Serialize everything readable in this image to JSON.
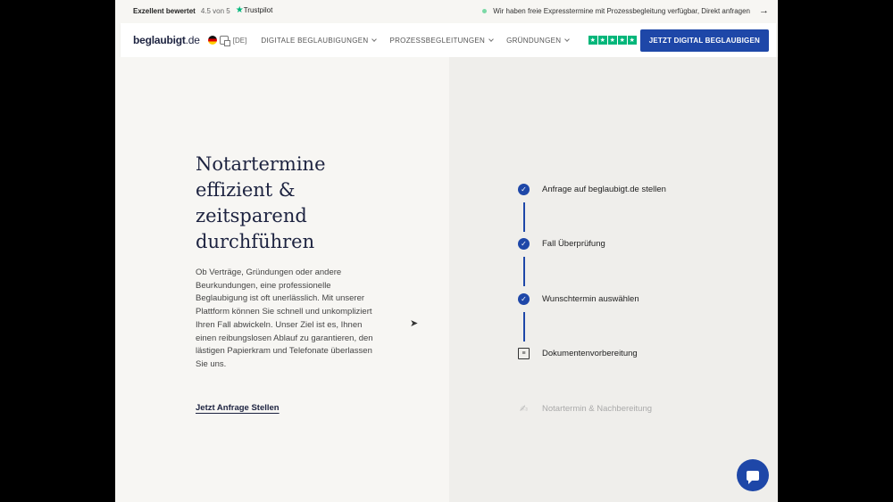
{
  "topbar": {
    "rating_label": "Exzellent bewertet",
    "rating_value": "4.5 von 5",
    "trustpilot": "Trustpilot",
    "promo": "Wir haben freie Expresstermine mit Prozessbegleitung verfügbar, Direkt anfragen"
  },
  "nav": {
    "logo_main": "beglaubigt",
    "logo_tld": ".de",
    "lang": "[DE]",
    "menu": [
      "DIGITALE BEGLAUBIGUNGEN",
      "PROZESSBEGLEITUNGEN",
      "GRÜNDUNGEN"
    ],
    "cta": "JETZT DIGITAL BEGLAUBIGEN"
  },
  "hero": {
    "headline": "Notartermine\neffizient &\nzeitsparend\ndurchführen",
    "body": "Ob Verträge, Gründungen oder andere Beurkundungen, eine professionelle Beglaubigung ist oft unerlässlich. Mit unserer Plattform können Sie schnell und unkompliziert Ihren Fall abwickeln. Unser Ziel ist es, Ihnen einen reibungslosen Ablauf zu garantieren, den lästigen Papierkram und Telefonate überlassen Sie uns.",
    "link": "Jetzt Anfrage Stellen"
  },
  "steps": [
    {
      "label": "Anfrage auf beglaubigt.de stellen",
      "icon": "check-circle-icon",
      "state": "done"
    },
    {
      "label": "Fall Überprüfung",
      "icon": "check-circle-icon",
      "state": "done"
    },
    {
      "label": "Wunschtermin auswählen",
      "icon": "check-circle-icon",
      "state": "done"
    },
    {
      "label": "Dokumentenvorbereitung",
      "icon": "document-icon",
      "state": "current"
    },
    {
      "label": "Notartermin & Nachbereitung",
      "icon": "signature-icon",
      "state": "pending"
    }
  ],
  "colors": {
    "accent": "#1e47a8",
    "trustpilot": "#00b67a",
    "ink": "#1d2340"
  }
}
